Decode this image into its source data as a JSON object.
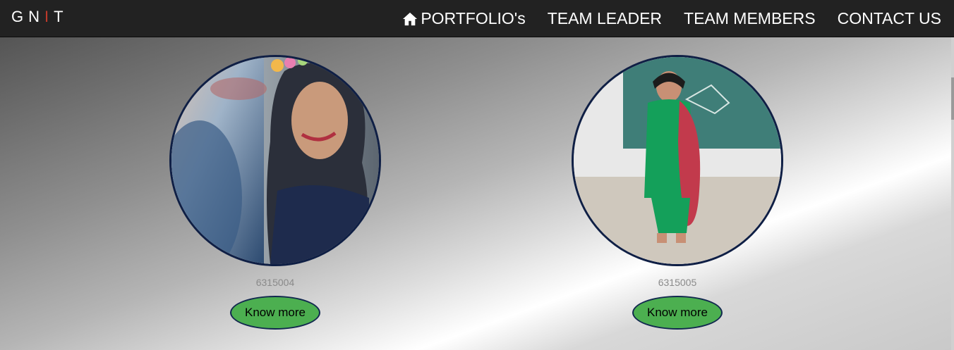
{
  "brand": {
    "letters": [
      "G",
      "N",
      "I",
      "T"
    ],
    "highlight_color": "#c0392b"
  },
  "nav": {
    "items": [
      {
        "label": "PORTFOLIO's",
        "icon": "home-icon"
      },
      {
        "label": "TEAM LEADER"
      },
      {
        "label": "TEAM MEMBERS"
      },
      {
        "label": "CONTACT US"
      }
    ]
  },
  "members": [
    {
      "id": "6315004",
      "button_label": "Know more"
    },
    {
      "id": "6315005",
      "button_label": "Know more"
    }
  ],
  "colors": {
    "navbar": "#222222",
    "button": "#4caf50",
    "border": "#0f1f45"
  }
}
